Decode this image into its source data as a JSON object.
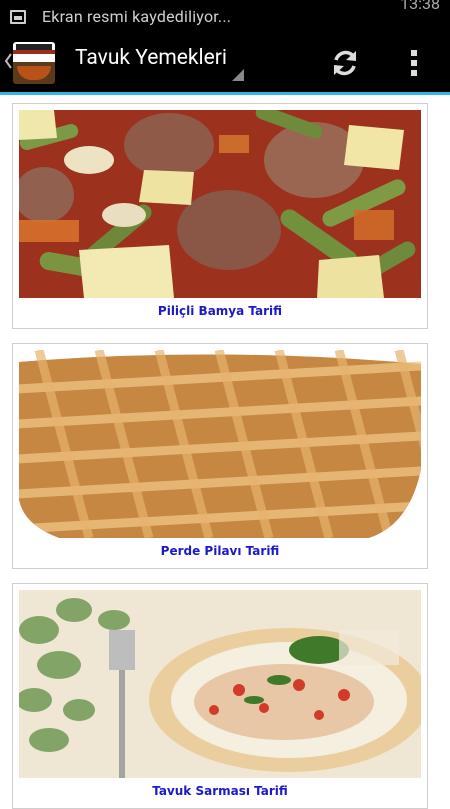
{
  "status_bar": {
    "notification_text": "Ekran resmi kaydediliyor...",
    "time": "13:38"
  },
  "action_bar": {
    "title": "Tavuk Yemekleri"
  },
  "recipes": [
    {
      "title": "Piliçli Bamya Tarifi"
    },
    {
      "title": "Perde Pilavı Tarifi"
    },
    {
      "title": "Tavuk Sarması Tarifi"
    }
  ],
  "colors": {
    "accent": "#33b5e5",
    "link": "#1a1ac8"
  }
}
